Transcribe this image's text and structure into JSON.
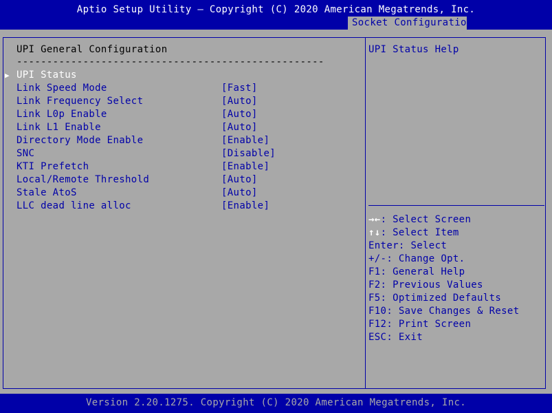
{
  "header": {
    "title": "Aptio Setup Utility – Copyright (C) 2020 American Megatrends, Inc.",
    "active_tab": "Socket Configuration"
  },
  "main": {
    "section_title": "UPI General Configuration",
    "separator": "---------------------------------------------------",
    "items": [
      {
        "label": "UPI Status",
        "value": "",
        "submenu": true,
        "selected": true
      },
      {
        "label": "Link Speed Mode",
        "value": "[Fast]"
      },
      {
        "label": "Link Frequency Select",
        "value": "[Auto]"
      },
      {
        "label": "Link L0p Enable",
        "value": "[Auto]"
      },
      {
        "label": "Link L1 Enable",
        "value": "[Auto]"
      },
      {
        "label": "Directory Mode Enable",
        "value": "[Enable]"
      },
      {
        "label": "SNC",
        "value": "[Disable]"
      },
      {
        "label": "KTI Prefetch",
        "value": "[Enable]"
      },
      {
        "label": "Local/Remote Threshold",
        "value": "[Auto]"
      },
      {
        "label": "Stale AtoS",
        "value": "[Auto]"
      },
      {
        "label": "LLC dead line alloc",
        "value": "[Enable]"
      }
    ]
  },
  "help": {
    "text": "UPI Status Help",
    "keys": [
      {
        "key": "→←",
        "desc": ": Select Screen"
      },
      {
        "key": "↑↓",
        "desc": ": Select Item"
      },
      {
        "key": "",
        "desc": "Enter: Select"
      },
      {
        "key": "",
        "desc": "+/-: Change Opt."
      },
      {
        "key": "",
        "desc": "F1: General Help"
      },
      {
        "key": "",
        "desc": "F2: Previous Values"
      },
      {
        "key": "",
        "desc": "F5: Optimized Defaults"
      },
      {
        "key": "",
        "desc": "F10: Save Changes & Reset"
      },
      {
        "key": "",
        "desc": "F12: Print Screen"
      },
      {
        "key": "",
        "desc": "ESC: Exit"
      }
    ]
  },
  "footer": {
    "version": "Version 2.20.1275. Copyright (C) 2020 American Megatrends, Inc."
  },
  "colors": {
    "background": "#a8a8a8",
    "bios_blue": "#0000a8",
    "highlight": "#ffffff"
  }
}
